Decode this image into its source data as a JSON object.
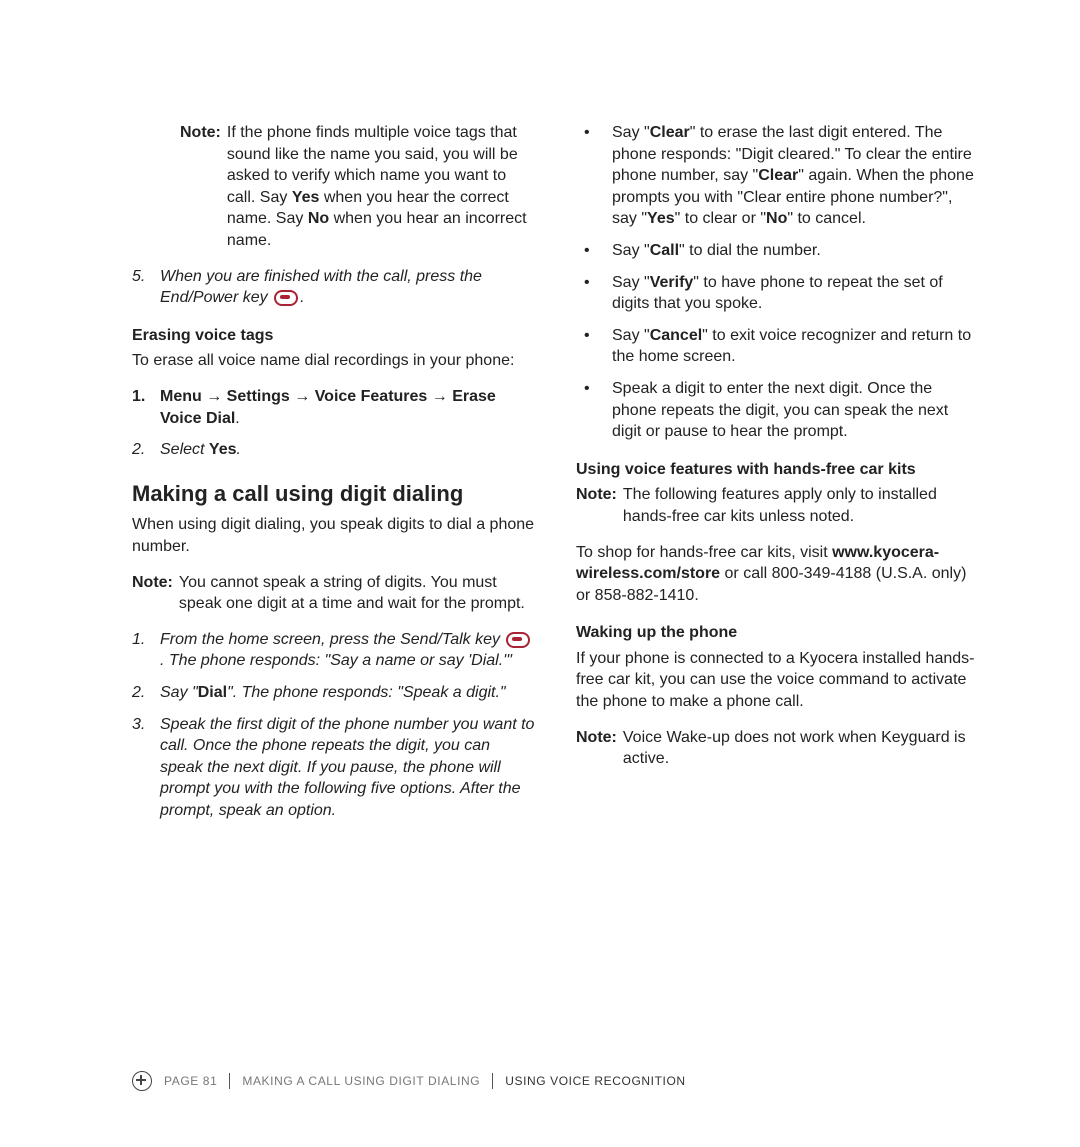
{
  "left": {
    "note1": {
      "label": "Note:",
      "text_a": "If the phone finds multiple voice tags that sound like the name you said, you will be asked to verify which name you want to call. Say ",
      "yes": "Yes",
      "text_b": " when you hear the correct name. Say ",
      "no": "No",
      "text_c": " when you hear an incorrect name."
    },
    "step5": {
      "num": "5.",
      "text_a": "When you are finished with the call, press the End/Power key ",
      "text_b": "."
    },
    "erasing_heading": "Erasing voice tags",
    "erasing_intro": "To erase all voice name dial recordings in your phone:",
    "erase_steps": {
      "s1": {
        "num": "1.",
        "menu": "Menu",
        "arrow1": " → ",
        "settings": "Settings",
        "arrow2": " → ",
        "voice": "Voice Features",
        "arrow3": " → ",
        "erase": "Erase Voice Dial",
        "period": "."
      },
      "s2": {
        "num": "2.",
        "text_a": "Select ",
        "yes": "Yes",
        "text_b": "."
      }
    },
    "digit_heading": "Making a call using digit dialing",
    "digit_intro": "When using digit dialing, you speak digits to dial a phone number.",
    "note2": {
      "label": "Note:",
      "text": "You cannot speak a string of digits. You must speak one digit at a time and wait for the prompt."
    },
    "digit_steps": {
      "s1": {
        "num": "1.",
        "text_a": "From the home screen, press the Send/Talk key ",
        "text_b": ". The phone responds: \"Say a name or say 'Dial.'\""
      },
      "s2": {
        "num": "2.",
        "text_a": "Say \"",
        "dial": "Dial",
        "text_b": "\". The phone responds: \"Speak a digit.\""
      },
      "s3": {
        "num": "3.",
        "text": "Speak the first digit of the phone number you want to call. Once the phone repeats the digit, you can speak the next digit. If you pause, the phone will prompt you with the following five options. After the prompt, speak an option."
      }
    }
  },
  "right": {
    "bullets": {
      "b1": {
        "t1": "Say \"",
        "clear": "Clear",
        "t2": "\" to erase the last digit entered. The phone responds: \"Digit cleared.\" To clear the entire phone number, say \"",
        "clear2": "Clear",
        "t3": "\" again. When the phone prompts you with \"Clear entire phone number?\", say \"",
        "yes": "Yes",
        "t4": "\" to clear or \"",
        "no": "No",
        "t5": "\" to cancel."
      },
      "b2": {
        "t1": "Say \"",
        "call": "Call",
        "t2": "\" to dial the number."
      },
      "b3": {
        "t1": "Say \"",
        "verify": "Verify",
        "t2": "\" to have phone to repeat the set of digits that you spoke."
      },
      "b4": {
        "t1": "Say \"",
        "cancel": "Cancel",
        "t2": "\" to exit voice recognizer and return to the home screen."
      },
      "b5": {
        "text": "Speak a digit to enter the next digit. Once the phone repeats the digit, you can speak the next digit or pause to hear the prompt."
      }
    },
    "handsfree_heading": "Using voice features with hands-free car kits",
    "handsfree_note": {
      "label": "Note:",
      "text": "The following features apply only to installed hands-free car kits unless noted."
    },
    "shop": {
      "t1": "To shop for hands-free car kits, visit ",
      "url": "www.kyocera-wireless.com/store",
      "t2": " or call 800-349-4188 (U.S.A. only) or 858-882-1410."
    },
    "waking_heading": "Waking up the phone",
    "waking_text": "If your phone is connected to a Kyocera installed hands-free car kit, you can use the voice command to activate the phone to make a phone call.",
    "waking_note": {
      "label": "Note:",
      "text": "Voice Wake-up does not work when Keyguard is active."
    }
  },
  "footer": {
    "page": "PAGE 81",
    "crumb1": "MAKING A CALL USING DIGIT DIALING",
    "crumb2": "USING VOICE RECOGNITION"
  }
}
